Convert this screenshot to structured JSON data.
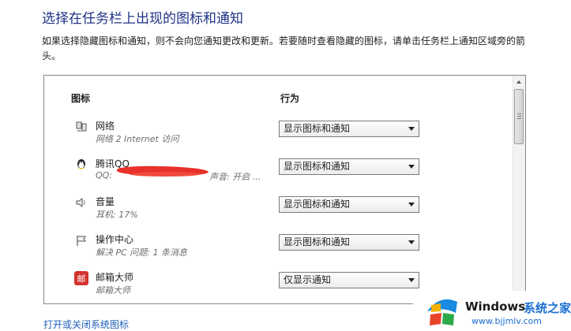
{
  "page": {
    "title": "选择在任务栏上出现的图标和通知",
    "description": "如果选择隐藏图标和通知，则不会向您通知更改和更新。若要随时查看隐藏的图标，请单击任务栏上通知区域旁的箭头。"
  },
  "table": {
    "col_icon": "图标",
    "col_behavior": "行为",
    "rows": [
      {
        "name": "网络",
        "sub": "网络 2 Internet 访问",
        "sub2": "",
        "behavior": "显示图标和通知",
        "icon": "network-icon"
      },
      {
        "name": "腾讯QQ",
        "sub": "QQ:",
        "sub2": "声音: 开启 ...",
        "behavior": "显示图标和通知",
        "icon": "qq-icon"
      },
      {
        "name": "音量",
        "sub": "耳机: 17%",
        "sub2": "",
        "behavior": "显示图标和通知",
        "icon": "volume-icon"
      },
      {
        "name": "操作中心",
        "sub": "解决 PC 问题: 1 条消息",
        "sub2": "",
        "behavior": "显示图标和通知",
        "icon": "action-center-flag-icon"
      },
      {
        "name": "邮箱大师",
        "sub": "邮箱大师",
        "sub2": "",
        "behavior": "仅显示通知",
        "icon": "mail-master-icon"
      }
    ]
  },
  "bottom_link": "打开或关闭系统图标",
  "watermark": {
    "brand": "Windows",
    "brand_cn": "系统之家",
    "url": "www.bjjmlv.com"
  },
  "colors": {
    "title": "#1e3287",
    "link": "#1e5fb8",
    "redaction": "#e8312a",
    "mail_icon": "#d2322d"
  }
}
